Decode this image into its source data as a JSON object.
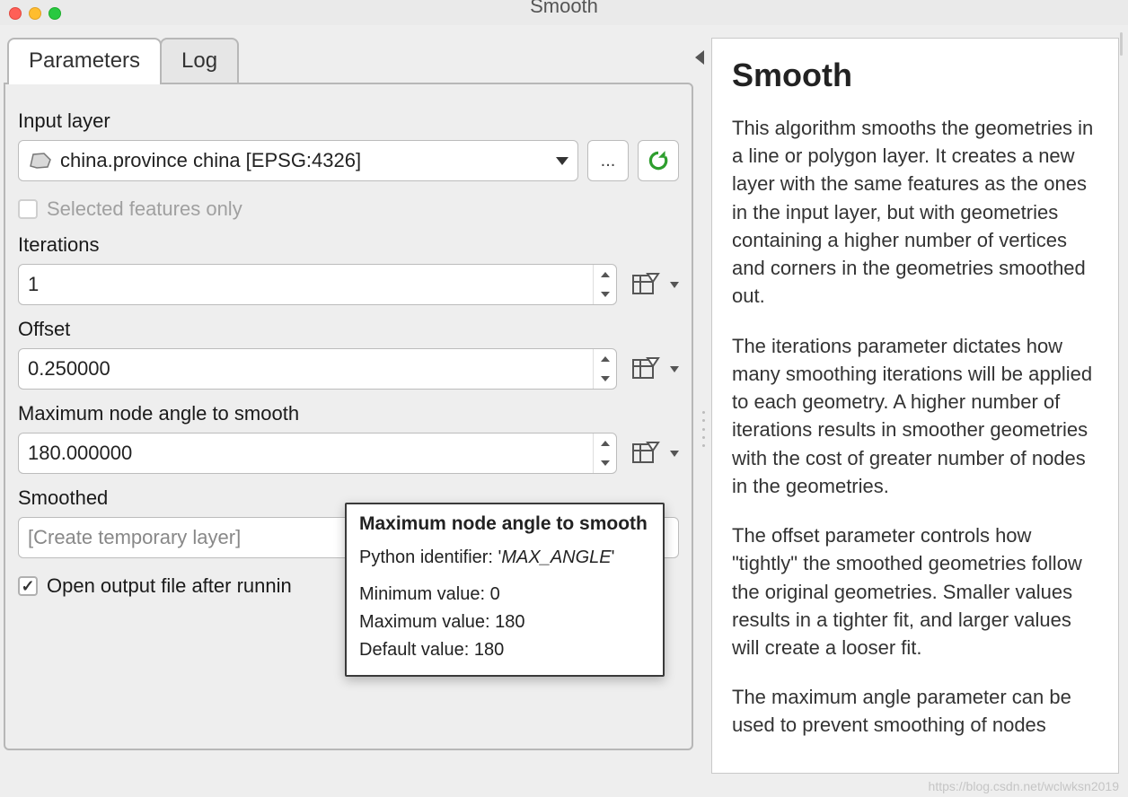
{
  "window": {
    "title": "Smooth"
  },
  "tabs": {
    "parameters": "Parameters",
    "log": "Log"
  },
  "params": {
    "input_layer_label": "Input layer",
    "input_layer_value": "china.province china [EPSG:4326]",
    "browse_btn": "...",
    "selected_only_label": "Selected features only",
    "iterations_label": "Iterations",
    "iterations_value": "1",
    "offset_label": "Offset",
    "offset_value": "0.250000",
    "max_angle_label": "Maximum node angle to smooth",
    "max_angle_value": "180.000000",
    "smoothed_label": "Smoothed",
    "smoothed_placeholder": "[Create temporary layer]",
    "open_output_label": "Open output file after running algorithm",
    "open_output_visible": "Open output file after runnin"
  },
  "tooltip": {
    "title": "Maximum node angle to smooth",
    "identifier_prefix": "Python identifier: '",
    "identifier": "MAX_ANGLE",
    "identifier_suffix": "'",
    "min_label": "Minimum value: ",
    "min_value": "0",
    "max_label": "Maximum value: ",
    "max_value": "180",
    "def_label": "Default value: ",
    "def_value": "180"
  },
  "help": {
    "title": "Smooth",
    "p1": "This algorithm smooths the geometries in a line or polygon layer. It creates a new layer with the same features as the ones in the input layer, but with geometries containing a higher number of vertices and corners in the geometries smoothed out.",
    "p2": "The iterations parameter dictates how many smoothing iterations will be applied to each geometry. A higher number of iterations results in smoother geometries with the cost of greater number of nodes in the geometries.",
    "p3": "The offset parameter controls how \"tightly\" the smoothed geometries follow the original geometries. Smaller values results in a tighter fit, and larger values will create a looser fit.",
    "p4": "The maximum angle parameter can be used to prevent smoothing of nodes"
  },
  "watermark": "https://blog.csdn.net/wclwksn2019"
}
